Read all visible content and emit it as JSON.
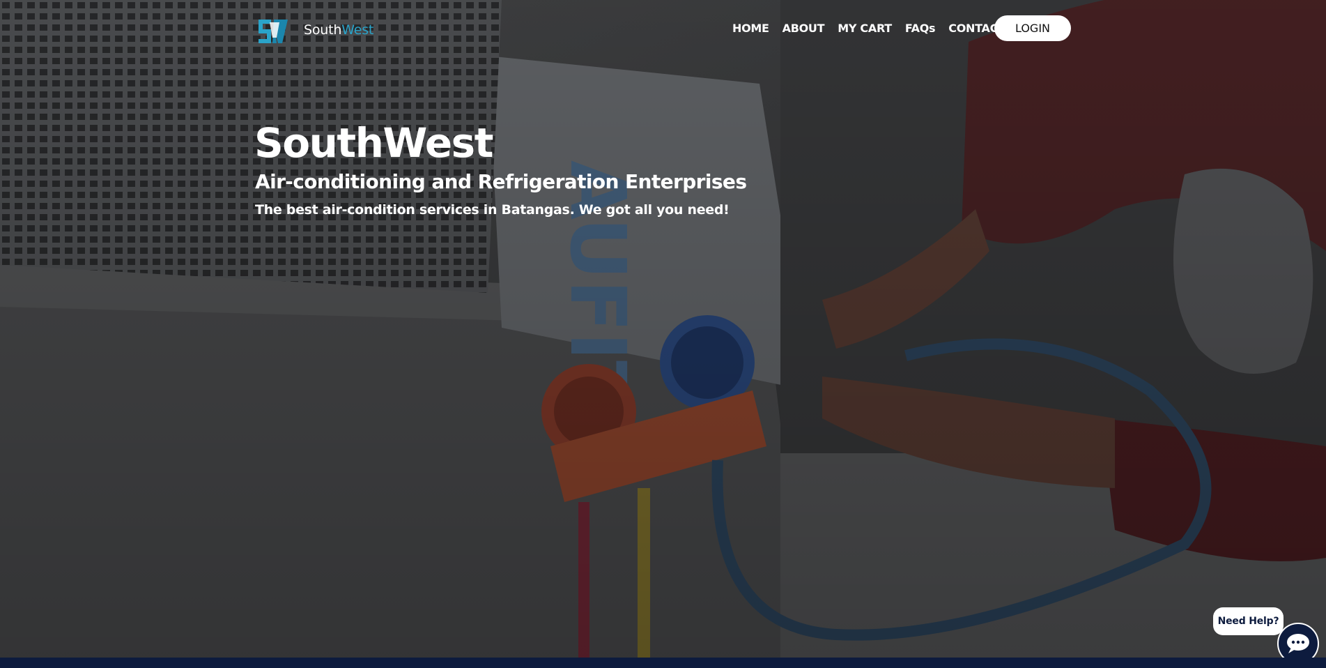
{
  "brand": {
    "name_part1": "South",
    "name_part2": "West",
    "accent_color": "#2aa3c9",
    "logo_icon": "southwest-logo-icon"
  },
  "nav": {
    "items": [
      {
        "label": "HOME"
      },
      {
        "label": "ABOUT"
      },
      {
        "label": "MY CART"
      },
      {
        "label": "FAQs"
      },
      {
        "label": "CONTACT"
      }
    ],
    "login_label": "LOGIN"
  },
  "hero": {
    "title": "SouthWest",
    "subtitle": "Air-conditioning and Refrigeration Enterprises",
    "tagline": "The best air-condition services in Batangas. We got all you need!"
  },
  "help": {
    "bubble_label": "Need Help?",
    "chat_icon": "chat-bubble-icon"
  },
  "colors": {
    "dark_navy": "#0d1b3e",
    "accent": "#2aa3c9"
  }
}
